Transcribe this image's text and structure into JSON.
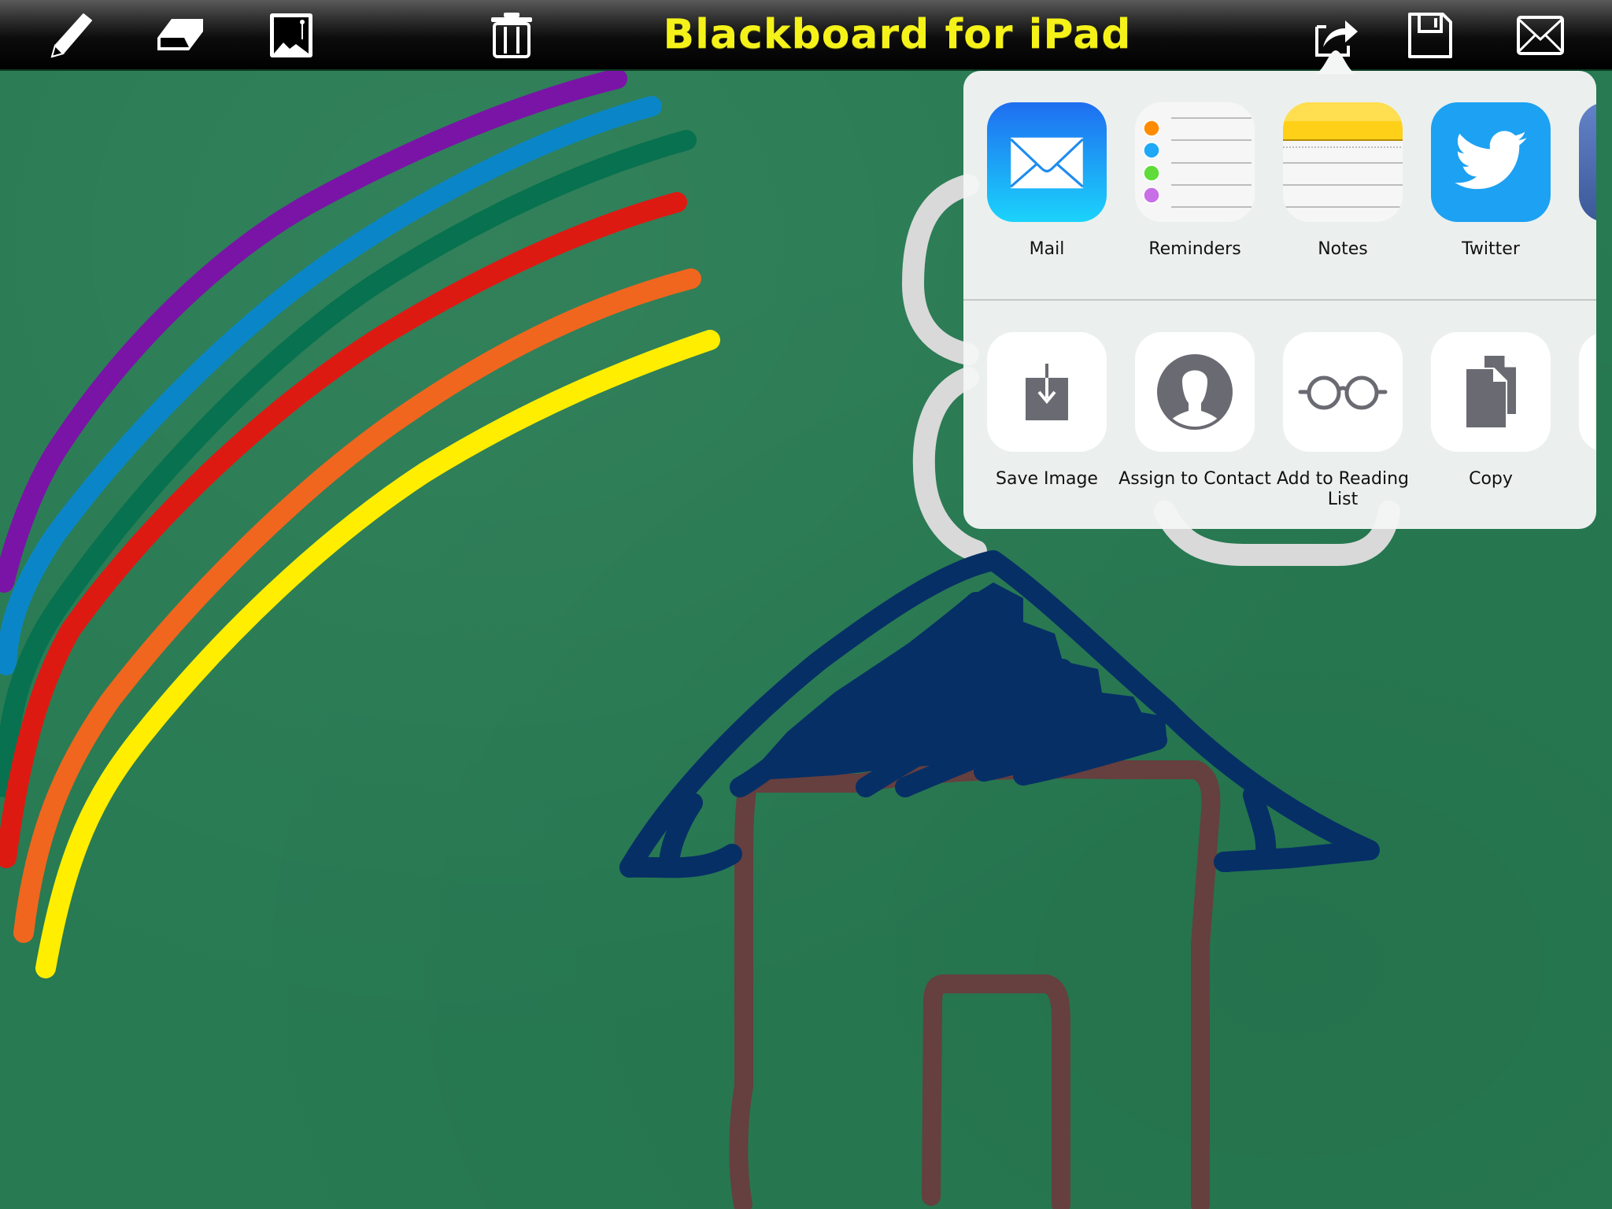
{
  "app": {
    "title": "Blackboard for iPad"
  },
  "toolbar": {
    "left_tools": [
      {
        "name": "pencil",
        "icon": "pencil-icon"
      },
      {
        "name": "eraser",
        "icon": "eraser-icon"
      },
      {
        "name": "background-image",
        "icon": "image-icon"
      },
      {
        "name": "clear",
        "icon": "trash-icon"
      }
    ],
    "right_tools": [
      {
        "name": "share",
        "icon": "share-icon",
        "active": true
      },
      {
        "name": "save",
        "icon": "floppy-disk-icon"
      },
      {
        "name": "email",
        "icon": "envelope-icon"
      }
    ]
  },
  "share_sheet": {
    "apps": [
      {
        "label": "Mail",
        "icon": "mail-app-icon"
      },
      {
        "label": "Reminders",
        "icon": "reminders-app-icon"
      },
      {
        "label": "Notes",
        "icon": "notes-app-icon"
      },
      {
        "label": "Twitter",
        "icon": "twitter-app-icon"
      },
      {
        "label": "",
        "icon": "facebook-app-icon",
        "partially_visible": true
      }
    ],
    "actions": [
      {
        "label": "Save Image",
        "icon": "save-image-icon"
      },
      {
        "label": "Assign to Contact",
        "icon": "contact-icon"
      },
      {
        "label": "Add to Reading List",
        "icon": "reading-glasses-icon"
      },
      {
        "label": "Copy",
        "icon": "copy-icon"
      },
      {
        "label": "",
        "icon": "more-action-icon",
        "partially_visible": true
      }
    ]
  },
  "canvas": {
    "background_color": "#277a52",
    "strokes": [
      {
        "name": "rainbow-purple",
        "color": "#7a14a6"
      },
      {
        "name": "rainbow-blue",
        "color": "#0a86c8"
      },
      {
        "name": "rainbow-teal",
        "color": "#08714f"
      },
      {
        "name": "rainbow-red",
        "color": "#dd1a12"
      },
      {
        "name": "rainbow-orange",
        "color": "#f0661e"
      },
      {
        "name": "rainbow-yellow",
        "color": "#ffee00"
      },
      {
        "name": "house-roof",
        "color": "#062f66"
      },
      {
        "name": "house-walls",
        "color": "#663f3f"
      },
      {
        "name": "grey-doodle",
        "color": "#d8d8d8"
      }
    ]
  }
}
